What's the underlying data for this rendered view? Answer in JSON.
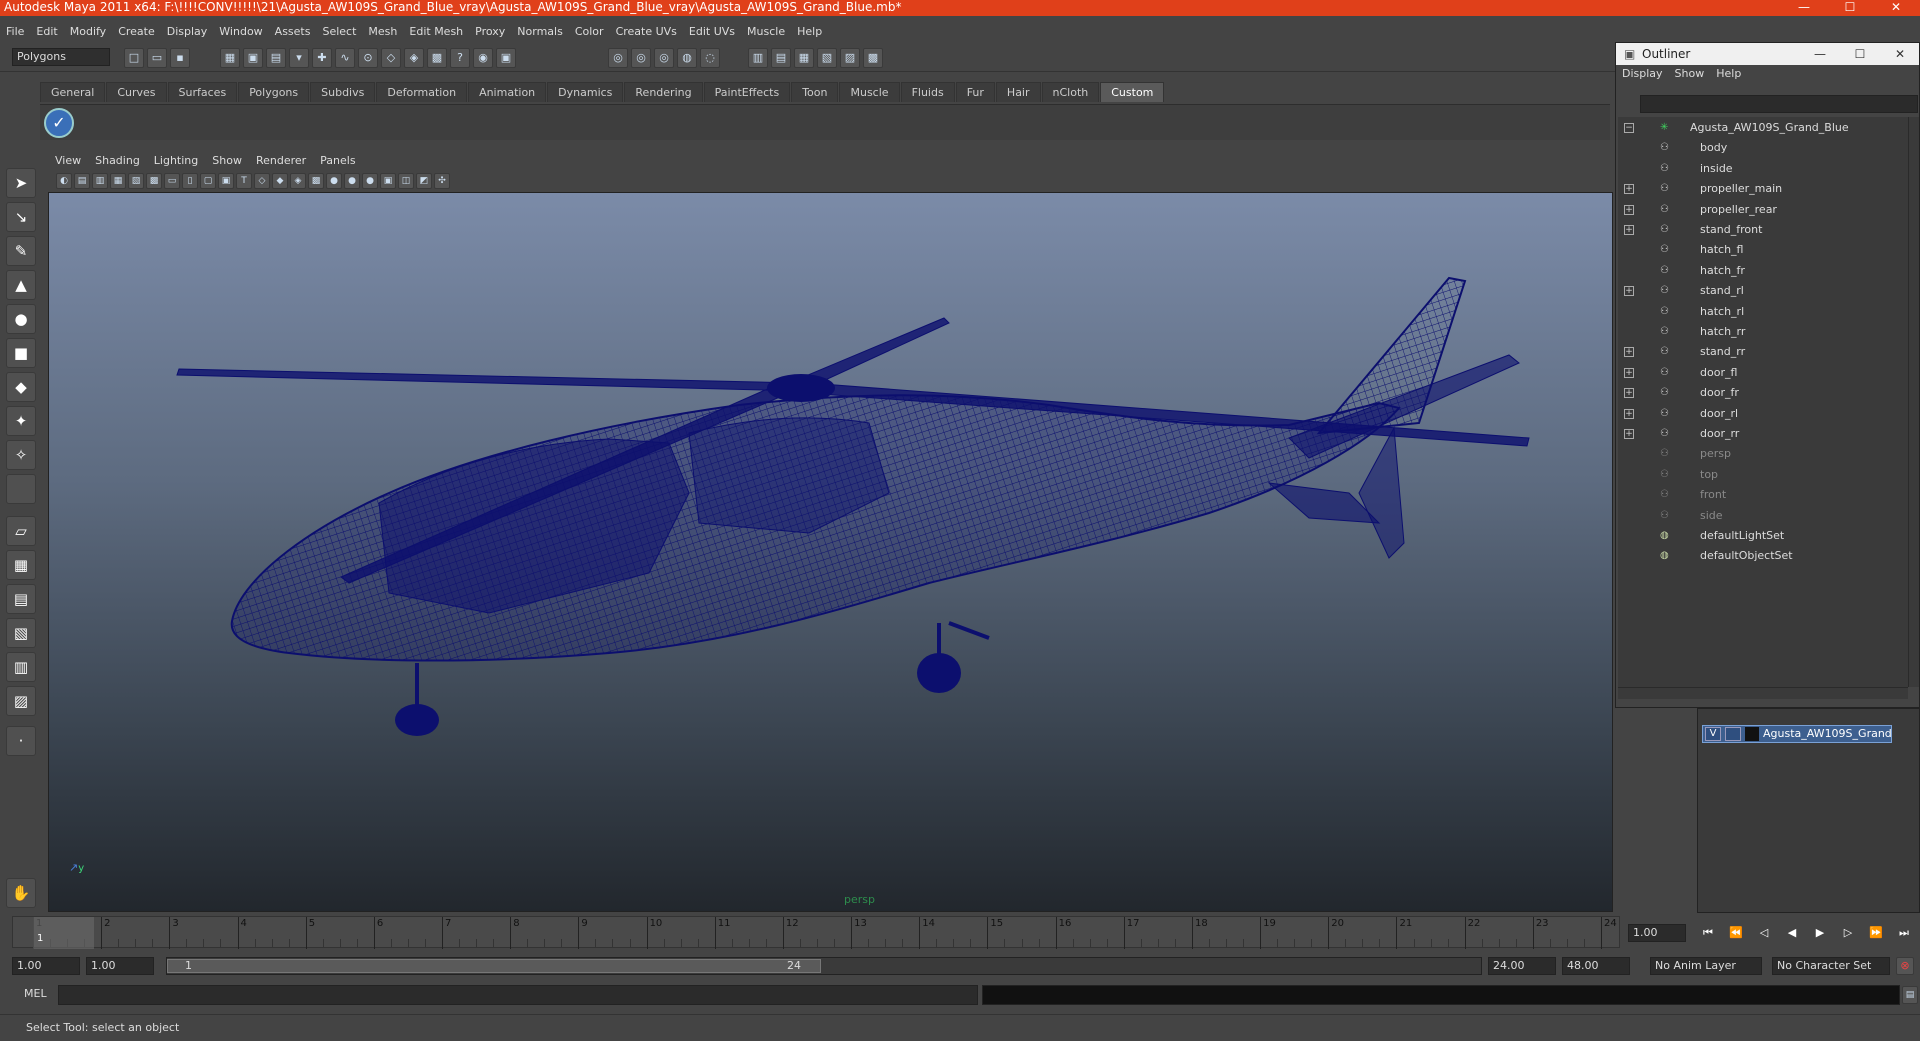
{
  "window": {
    "title": "Autodesk Maya 2011 x64: F:\\!!!!CONV!!!!!\\21\\Agusta_AW109S_Grand_Blue_vray\\Agusta_AW109S_Grand_Blue_vray\\Agusta_AW109S_Grand_Blue.mb*",
    "minimize": "—",
    "maximize": "☐",
    "close": "✕"
  },
  "menu": [
    "File",
    "Edit",
    "Modify",
    "Create",
    "Display",
    "Window",
    "Assets",
    "Select",
    "Mesh",
    "Edit Mesh",
    "Proxy",
    "Normals",
    "Color",
    "Create UVs",
    "Edit UVs",
    "Muscle",
    "Help"
  ],
  "status": {
    "mode": "Polygons"
  },
  "shelf": {
    "tabs": [
      "General",
      "Curves",
      "Surfaces",
      "Polygons",
      "Subdivs",
      "Deformation",
      "Animation",
      "Dynamics",
      "Rendering",
      "PaintEffects",
      "Toon",
      "Muscle",
      "Fluids",
      "Fur",
      "Hair",
      "nCloth",
      "Custom"
    ],
    "active_tab": "Custom"
  },
  "panel_menu": [
    "View",
    "Shading",
    "Lighting",
    "Show",
    "Renderer",
    "Panels"
  ],
  "viewport": {
    "camera_label": "persp",
    "axis_y": "y"
  },
  "outliner": {
    "title": "Outliner",
    "menu": [
      "Display",
      "Show",
      "Help"
    ],
    "root": "Agusta_AW109S_Grand_Blue",
    "children": [
      {
        "name": "body",
        "expand": false
      },
      {
        "name": "inside",
        "expand": false
      },
      {
        "name": "propeller_main",
        "expand": true
      },
      {
        "name": "propeller_rear",
        "expand": true
      },
      {
        "name": "stand_front",
        "expand": true
      },
      {
        "name": "hatch_fl",
        "expand": false
      },
      {
        "name": "hatch_fr",
        "expand": false
      },
      {
        "name": "stand_rl",
        "expand": true
      },
      {
        "name": "hatch_rl",
        "expand": false
      },
      {
        "name": "hatch_rr",
        "expand": false
      },
      {
        "name": "stand_rr",
        "expand": true
      },
      {
        "name": "door_fl",
        "expand": true
      },
      {
        "name": "door_fr",
        "expand": true
      },
      {
        "name": "door_rl",
        "expand": true
      },
      {
        "name": "door_rr",
        "expand": true
      }
    ],
    "cameras": [
      "persp",
      "top",
      "front",
      "side"
    ],
    "sets": [
      "defaultLightSet",
      "defaultObjectSet"
    ]
  },
  "layers": {
    "visible_flag": "V",
    "layer_name": "Agusta_AW109S_Grand_"
  },
  "timeline": {
    "ticks": [
      "1",
      "2",
      "3",
      "4",
      "5",
      "6",
      "7",
      "8",
      "9",
      "10",
      "11",
      "12",
      "13",
      "14",
      "15",
      "16",
      "17",
      "18",
      "19",
      "20",
      "21",
      "22",
      "23",
      "24"
    ],
    "current_frame": "1.00",
    "current_marker": "1"
  },
  "range": {
    "start": "1.00",
    "playback_start": "1.00",
    "slider_start": "1",
    "slider_end": "24",
    "playback_end": "24.00",
    "end": "48.00",
    "anim_layer": "No Anim Layer",
    "character_set": "No Character Set"
  },
  "command": {
    "label": "MEL"
  },
  "help_line": "Select Tool: select an object",
  "colors": {
    "titlebar": "#e0401a",
    "wire": "#0c0f6e",
    "viewport_top": "#7b8ba8",
    "viewport_bottom": "#22272d"
  }
}
